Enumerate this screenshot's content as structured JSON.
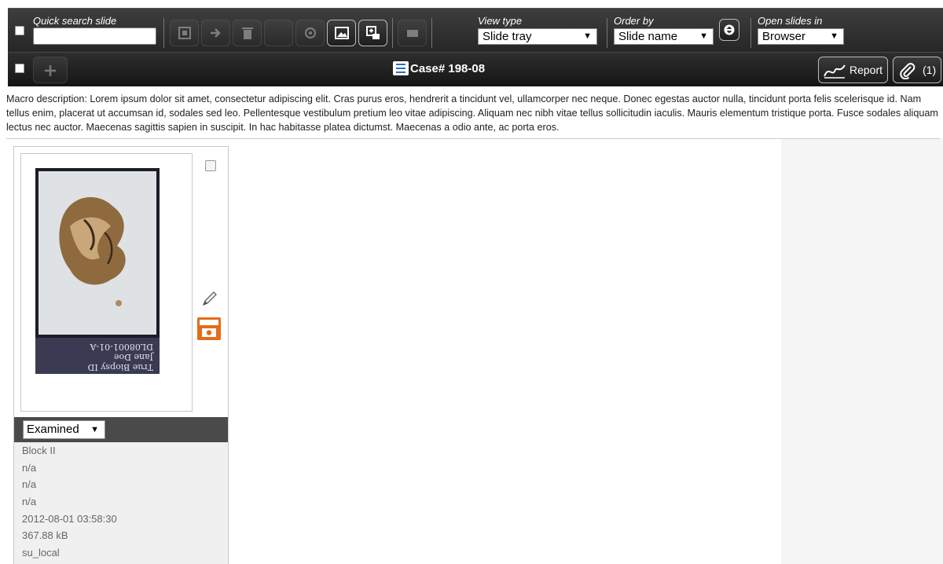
{
  "toolbar": {
    "quick_search_label": "Quick search slide",
    "quick_search_value": "",
    "view_type_label": "View type",
    "view_type_value": "Slide tray",
    "order_by_label": "Order by",
    "order_by_value": "Slide name",
    "open_in_label": "Open slides in",
    "open_in_value": "Browser"
  },
  "case": {
    "title": "Case# 198-08",
    "report_label": "Report",
    "attachments_count": "(1)"
  },
  "description": "Macro description:  Lorem ipsum dolor sit amet, consectetur adipiscing elit. Cras purus eros, hendrerit a tincidunt vel, ullamcorper nec neque. Donec egestas auctor nulla, tincidunt porta felis scelerisque id. Nam tellus enim, placerat ut accumsan id, sodales sed leo. Pellentesque vestibulum pretium leo vitae adipiscing. Aliquam nec nibh vitae tellus sollicitudin iaculis. Mauris elementum tristique porta. Fusce sodales aliquam lectus nec auctor. Maecenas sagittis sapien in suscipit. In hac habitasse platea dictumst. Maecenas a odio ante, ac porta eros.",
  "slide": {
    "label_lines": [
      "True Biopsy ID",
      "Jane Doe",
      "DL08001-01-A"
    ],
    "status": "Examined",
    "meta": [
      "Block II",
      "n/a",
      "n/a",
      "n/a",
      "2012-08-01 03:58:30",
      "367.88 kB",
      "su_local"
    ]
  },
  "icons": {
    "toolbar": [
      "scan-icon",
      "export-icon",
      "delete-icon",
      "blank-icon",
      "email-icon",
      "image-icon",
      "add-snapshot-icon",
      "compare-icon"
    ],
    "case": "case-list-icon",
    "report": "signature-icon",
    "attachment": "paperclip-icon",
    "edit": "pencil-icon",
    "snapshot": "camera-icon"
  },
  "colors": {
    "toolbar_bg": "#303030",
    "case_bar_bg": "#1f1f1f",
    "accent_orange": "#e46c1a",
    "case_icon_blue": "#2b6dbd"
  }
}
